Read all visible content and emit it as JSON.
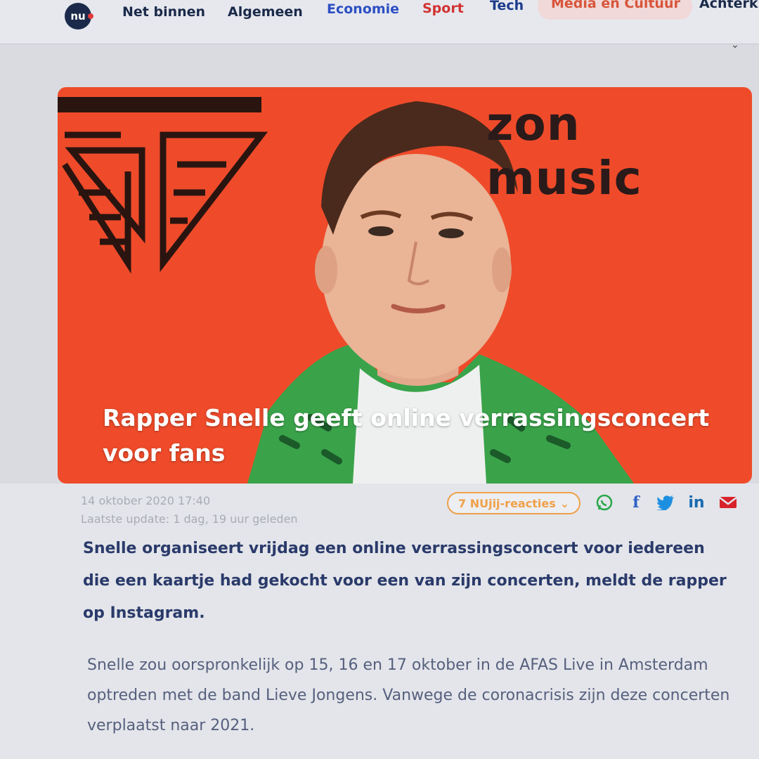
{
  "nav": {
    "logo_text": "nu",
    "items": [
      {
        "label": "Net binnen",
        "color": "#1b2a4a"
      },
      {
        "label": "Algemeen",
        "color": "#1b2a4a"
      },
      {
        "label": "Economie",
        "color": "#2d4fc4"
      },
      {
        "label": "Sport",
        "color": "#d23232"
      },
      {
        "label": "Tech",
        "color": "#1b3a8a"
      },
      {
        "label": "Media en Cultuur",
        "color": "#d8553a"
      },
      {
        "label": "Achterkl",
        "color": "#1b2a4a"
      }
    ]
  },
  "hero": {
    "brand_text": "zon music",
    "title": "Rapper Snelle geeft online verrassingsconcert voor fans"
  },
  "meta": {
    "published": "14 oktober 2020 17:40",
    "updated": "Laatste update: 1 dag, 19 uur geleden"
  },
  "reactions": {
    "label": "7 NUjij-reacties",
    "color": "#f0a04a"
  },
  "share": [
    {
      "icon": "whatsapp-icon",
      "color": "#2aa84a"
    },
    {
      "icon": "facebook-icon",
      "color": "#2d5fc4"
    },
    {
      "icon": "twitter-icon",
      "color": "#1d8fe0"
    },
    {
      "icon": "linkedin-icon",
      "color": "#1a6ab0"
    },
    {
      "icon": "mail-icon",
      "color": "#d8222a"
    }
  ],
  "article": {
    "lead": "Snelle organiseert vrijdag een online verrassingsconcert voor iedereen die een kaartje had gekocht voor een van zijn concerten, meldt de rapper op Instagram.",
    "body": "Snelle zou oorspronkelijk op 15, 16 en 17 oktober in de AFAS Live in Amsterdam optreden met de band Lieve Jongens. Vanwege de coronacrisis zijn deze concerten verplaatst naar 2021."
  }
}
